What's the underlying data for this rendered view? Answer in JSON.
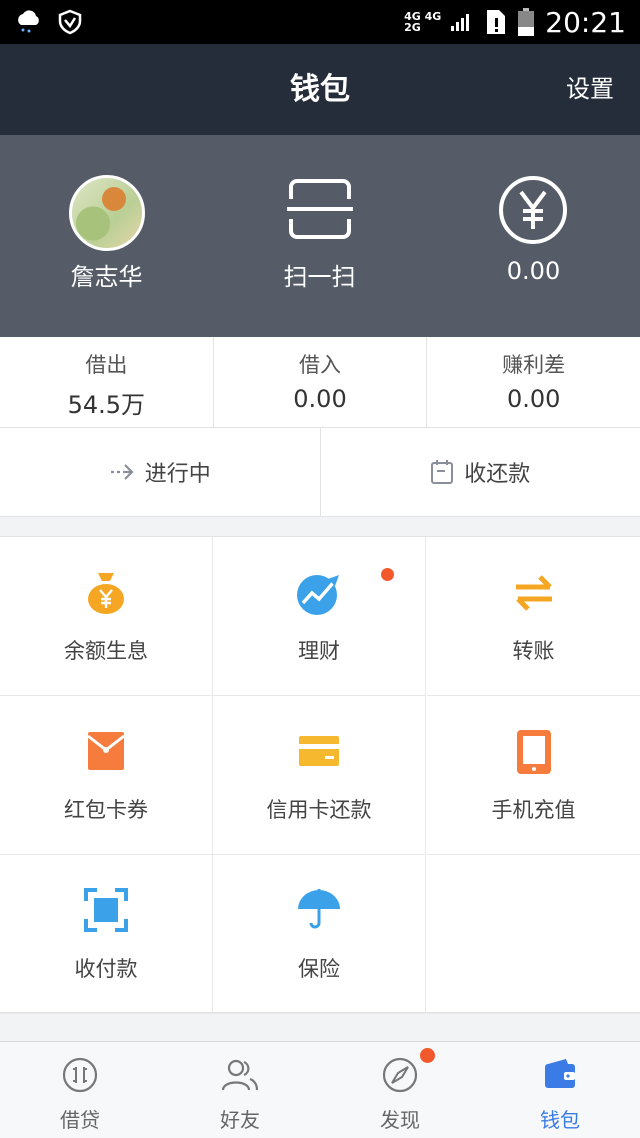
{
  "status_bar": {
    "network_top": "4G 4G",
    "network_bottom": "2G",
    "time": "20:21",
    "icons": [
      "weather-cloud-icon",
      "shield-icon",
      "signal-icon",
      "sim-icon",
      "battery-icon"
    ]
  },
  "header": {
    "title": "钱包",
    "settings_label": "设置",
    "bg_color": "#252c3a"
  },
  "hero": {
    "user_name": "詹志华",
    "scan_label": "扫一扫",
    "balance": "0.00",
    "bg_color": "#565c67"
  },
  "stats": [
    {
      "label": "借出",
      "value": "54.5万"
    },
    {
      "label": "借入",
      "value": "0.00"
    },
    {
      "label": "赚利差",
      "value": "0.00"
    }
  ],
  "actions": [
    {
      "label": "进行中",
      "icon": "arrow-right-icon"
    },
    {
      "label": "收还款",
      "icon": "calendar-icon"
    }
  ],
  "grid": [
    {
      "label": "余额生息",
      "icon": "money-bag-icon",
      "color": "#f5a623",
      "badge": false
    },
    {
      "label": "理财",
      "icon": "trend-chart-icon",
      "color": "#3ba1e8",
      "badge": true
    },
    {
      "label": "转账",
      "icon": "transfer-icon",
      "color": "#f5a623",
      "badge": false
    },
    {
      "label": "红包卡券",
      "icon": "red-packet-icon",
      "color": "#f57c3c",
      "badge": false
    },
    {
      "label": "信用卡还款",
      "icon": "credit-card-icon",
      "color": "#f5b82e",
      "badge": false
    },
    {
      "label": "手机充值",
      "icon": "phone-icon",
      "color": "#f57c3c",
      "badge": false
    },
    {
      "label": "收付款",
      "icon": "scan-frame-icon",
      "color": "#3ba1e8",
      "badge": false
    },
    {
      "label": "保险",
      "icon": "umbrella-icon",
      "color": "#3ba1e8",
      "badge": false
    }
  ],
  "bottom_nav": [
    {
      "label": "借贷",
      "icon": "loan-icon",
      "active": false,
      "badge": false
    },
    {
      "label": "好友",
      "icon": "friends-icon",
      "active": false,
      "badge": false
    },
    {
      "label": "发现",
      "icon": "compass-icon",
      "active": false,
      "badge": true
    },
    {
      "label": "钱包",
      "icon": "wallet-icon",
      "active": true,
      "badge": false
    }
  ],
  "colors": {
    "accent": "#3a7be6",
    "badge": "#f1582b"
  }
}
